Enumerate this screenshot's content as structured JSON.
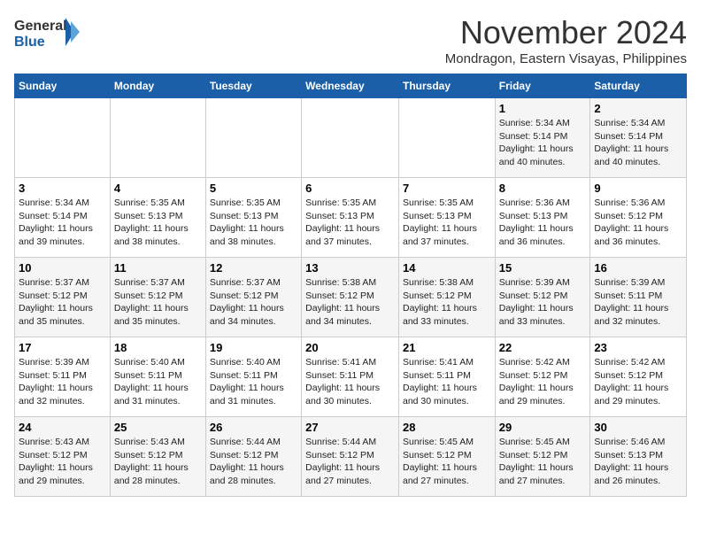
{
  "header": {
    "logo_general": "General",
    "logo_blue": "Blue",
    "month_title": "November 2024",
    "location": "Mondragon, Eastern Visayas, Philippines"
  },
  "weekdays": [
    "Sunday",
    "Monday",
    "Tuesday",
    "Wednesday",
    "Thursday",
    "Friday",
    "Saturday"
  ],
  "weeks": [
    [
      {
        "day": "",
        "info": ""
      },
      {
        "day": "",
        "info": ""
      },
      {
        "day": "",
        "info": ""
      },
      {
        "day": "",
        "info": ""
      },
      {
        "day": "",
        "info": ""
      },
      {
        "day": "1",
        "info": "Sunrise: 5:34 AM\nSunset: 5:14 PM\nDaylight: 11 hours\nand 40 minutes."
      },
      {
        "day": "2",
        "info": "Sunrise: 5:34 AM\nSunset: 5:14 PM\nDaylight: 11 hours\nand 40 minutes."
      }
    ],
    [
      {
        "day": "3",
        "info": "Sunrise: 5:34 AM\nSunset: 5:14 PM\nDaylight: 11 hours\nand 39 minutes."
      },
      {
        "day": "4",
        "info": "Sunrise: 5:35 AM\nSunset: 5:13 PM\nDaylight: 11 hours\nand 38 minutes."
      },
      {
        "day": "5",
        "info": "Sunrise: 5:35 AM\nSunset: 5:13 PM\nDaylight: 11 hours\nand 38 minutes."
      },
      {
        "day": "6",
        "info": "Sunrise: 5:35 AM\nSunset: 5:13 PM\nDaylight: 11 hours\nand 37 minutes."
      },
      {
        "day": "7",
        "info": "Sunrise: 5:35 AM\nSunset: 5:13 PM\nDaylight: 11 hours\nand 37 minutes."
      },
      {
        "day": "8",
        "info": "Sunrise: 5:36 AM\nSunset: 5:13 PM\nDaylight: 11 hours\nand 36 minutes."
      },
      {
        "day": "9",
        "info": "Sunrise: 5:36 AM\nSunset: 5:12 PM\nDaylight: 11 hours\nand 36 minutes."
      }
    ],
    [
      {
        "day": "10",
        "info": "Sunrise: 5:37 AM\nSunset: 5:12 PM\nDaylight: 11 hours\nand 35 minutes."
      },
      {
        "day": "11",
        "info": "Sunrise: 5:37 AM\nSunset: 5:12 PM\nDaylight: 11 hours\nand 35 minutes."
      },
      {
        "day": "12",
        "info": "Sunrise: 5:37 AM\nSunset: 5:12 PM\nDaylight: 11 hours\nand 34 minutes."
      },
      {
        "day": "13",
        "info": "Sunrise: 5:38 AM\nSunset: 5:12 PM\nDaylight: 11 hours\nand 34 minutes."
      },
      {
        "day": "14",
        "info": "Sunrise: 5:38 AM\nSunset: 5:12 PM\nDaylight: 11 hours\nand 33 minutes."
      },
      {
        "day": "15",
        "info": "Sunrise: 5:39 AM\nSunset: 5:12 PM\nDaylight: 11 hours\nand 33 minutes."
      },
      {
        "day": "16",
        "info": "Sunrise: 5:39 AM\nSunset: 5:11 PM\nDaylight: 11 hours\nand 32 minutes."
      }
    ],
    [
      {
        "day": "17",
        "info": "Sunrise: 5:39 AM\nSunset: 5:11 PM\nDaylight: 11 hours\nand 32 minutes."
      },
      {
        "day": "18",
        "info": "Sunrise: 5:40 AM\nSunset: 5:11 PM\nDaylight: 11 hours\nand 31 minutes."
      },
      {
        "day": "19",
        "info": "Sunrise: 5:40 AM\nSunset: 5:11 PM\nDaylight: 11 hours\nand 31 minutes."
      },
      {
        "day": "20",
        "info": "Sunrise: 5:41 AM\nSunset: 5:11 PM\nDaylight: 11 hours\nand 30 minutes."
      },
      {
        "day": "21",
        "info": "Sunrise: 5:41 AM\nSunset: 5:11 PM\nDaylight: 11 hours\nand 30 minutes."
      },
      {
        "day": "22",
        "info": "Sunrise: 5:42 AM\nSunset: 5:12 PM\nDaylight: 11 hours\nand 29 minutes."
      },
      {
        "day": "23",
        "info": "Sunrise: 5:42 AM\nSunset: 5:12 PM\nDaylight: 11 hours\nand 29 minutes."
      }
    ],
    [
      {
        "day": "24",
        "info": "Sunrise: 5:43 AM\nSunset: 5:12 PM\nDaylight: 11 hours\nand 29 minutes."
      },
      {
        "day": "25",
        "info": "Sunrise: 5:43 AM\nSunset: 5:12 PM\nDaylight: 11 hours\nand 28 minutes."
      },
      {
        "day": "26",
        "info": "Sunrise: 5:44 AM\nSunset: 5:12 PM\nDaylight: 11 hours\nand 28 minutes."
      },
      {
        "day": "27",
        "info": "Sunrise: 5:44 AM\nSunset: 5:12 PM\nDaylight: 11 hours\nand 27 minutes."
      },
      {
        "day": "28",
        "info": "Sunrise: 5:45 AM\nSunset: 5:12 PM\nDaylight: 11 hours\nand 27 minutes."
      },
      {
        "day": "29",
        "info": "Sunrise: 5:45 AM\nSunset: 5:12 PM\nDaylight: 11 hours\nand 27 minutes."
      },
      {
        "day": "30",
        "info": "Sunrise: 5:46 AM\nSunset: 5:13 PM\nDaylight: 11 hours\nand 26 minutes."
      }
    ]
  ]
}
